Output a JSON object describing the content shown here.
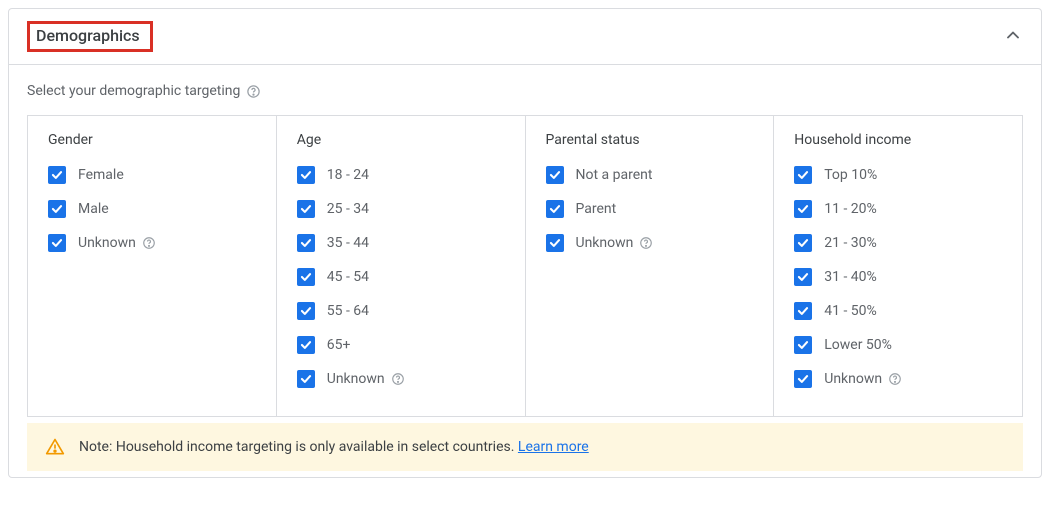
{
  "header": {
    "title": "Demographics"
  },
  "subtitle": "Select your demographic targeting",
  "columns": [
    {
      "id": "gender",
      "title": "Gender",
      "options": [
        {
          "label": "Female",
          "checked": true,
          "help": false
        },
        {
          "label": "Male",
          "checked": true,
          "help": false
        },
        {
          "label": "Unknown",
          "checked": true,
          "help": true
        }
      ]
    },
    {
      "id": "age",
      "title": "Age",
      "options": [
        {
          "label": "18 - 24",
          "checked": true,
          "help": false
        },
        {
          "label": "25 - 34",
          "checked": true,
          "help": false
        },
        {
          "label": "35 - 44",
          "checked": true,
          "help": false
        },
        {
          "label": "45 - 54",
          "checked": true,
          "help": false
        },
        {
          "label": "55 - 64",
          "checked": true,
          "help": false
        },
        {
          "label": "65+",
          "checked": true,
          "help": false
        },
        {
          "label": "Unknown",
          "checked": true,
          "help": true
        }
      ]
    },
    {
      "id": "parental-status",
      "title": "Parental status",
      "options": [
        {
          "label": "Not a parent",
          "checked": true,
          "help": false
        },
        {
          "label": "Parent",
          "checked": true,
          "help": false
        },
        {
          "label": "Unknown",
          "checked": true,
          "help": true
        }
      ]
    },
    {
      "id": "household-income",
      "title": "Household income",
      "options": [
        {
          "label": "Top 10%",
          "checked": true,
          "help": false
        },
        {
          "label": "11 - 20%",
          "checked": true,
          "help": false
        },
        {
          "label": "21 - 30%",
          "checked": true,
          "help": false
        },
        {
          "label": "31 - 40%",
          "checked": true,
          "help": false
        },
        {
          "label": "41 - 50%",
          "checked": true,
          "help": false
        },
        {
          "label": "Lower 50%",
          "checked": true,
          "help": false
        },
        {
          "label": "Unknown",
          "checked": true,
          "help": true
        }
      ]
    }
  ],
  "note": {
    "text": "Note: Household income targeting is only available in select countries.",
    "link": "Learn more"
  }
}
